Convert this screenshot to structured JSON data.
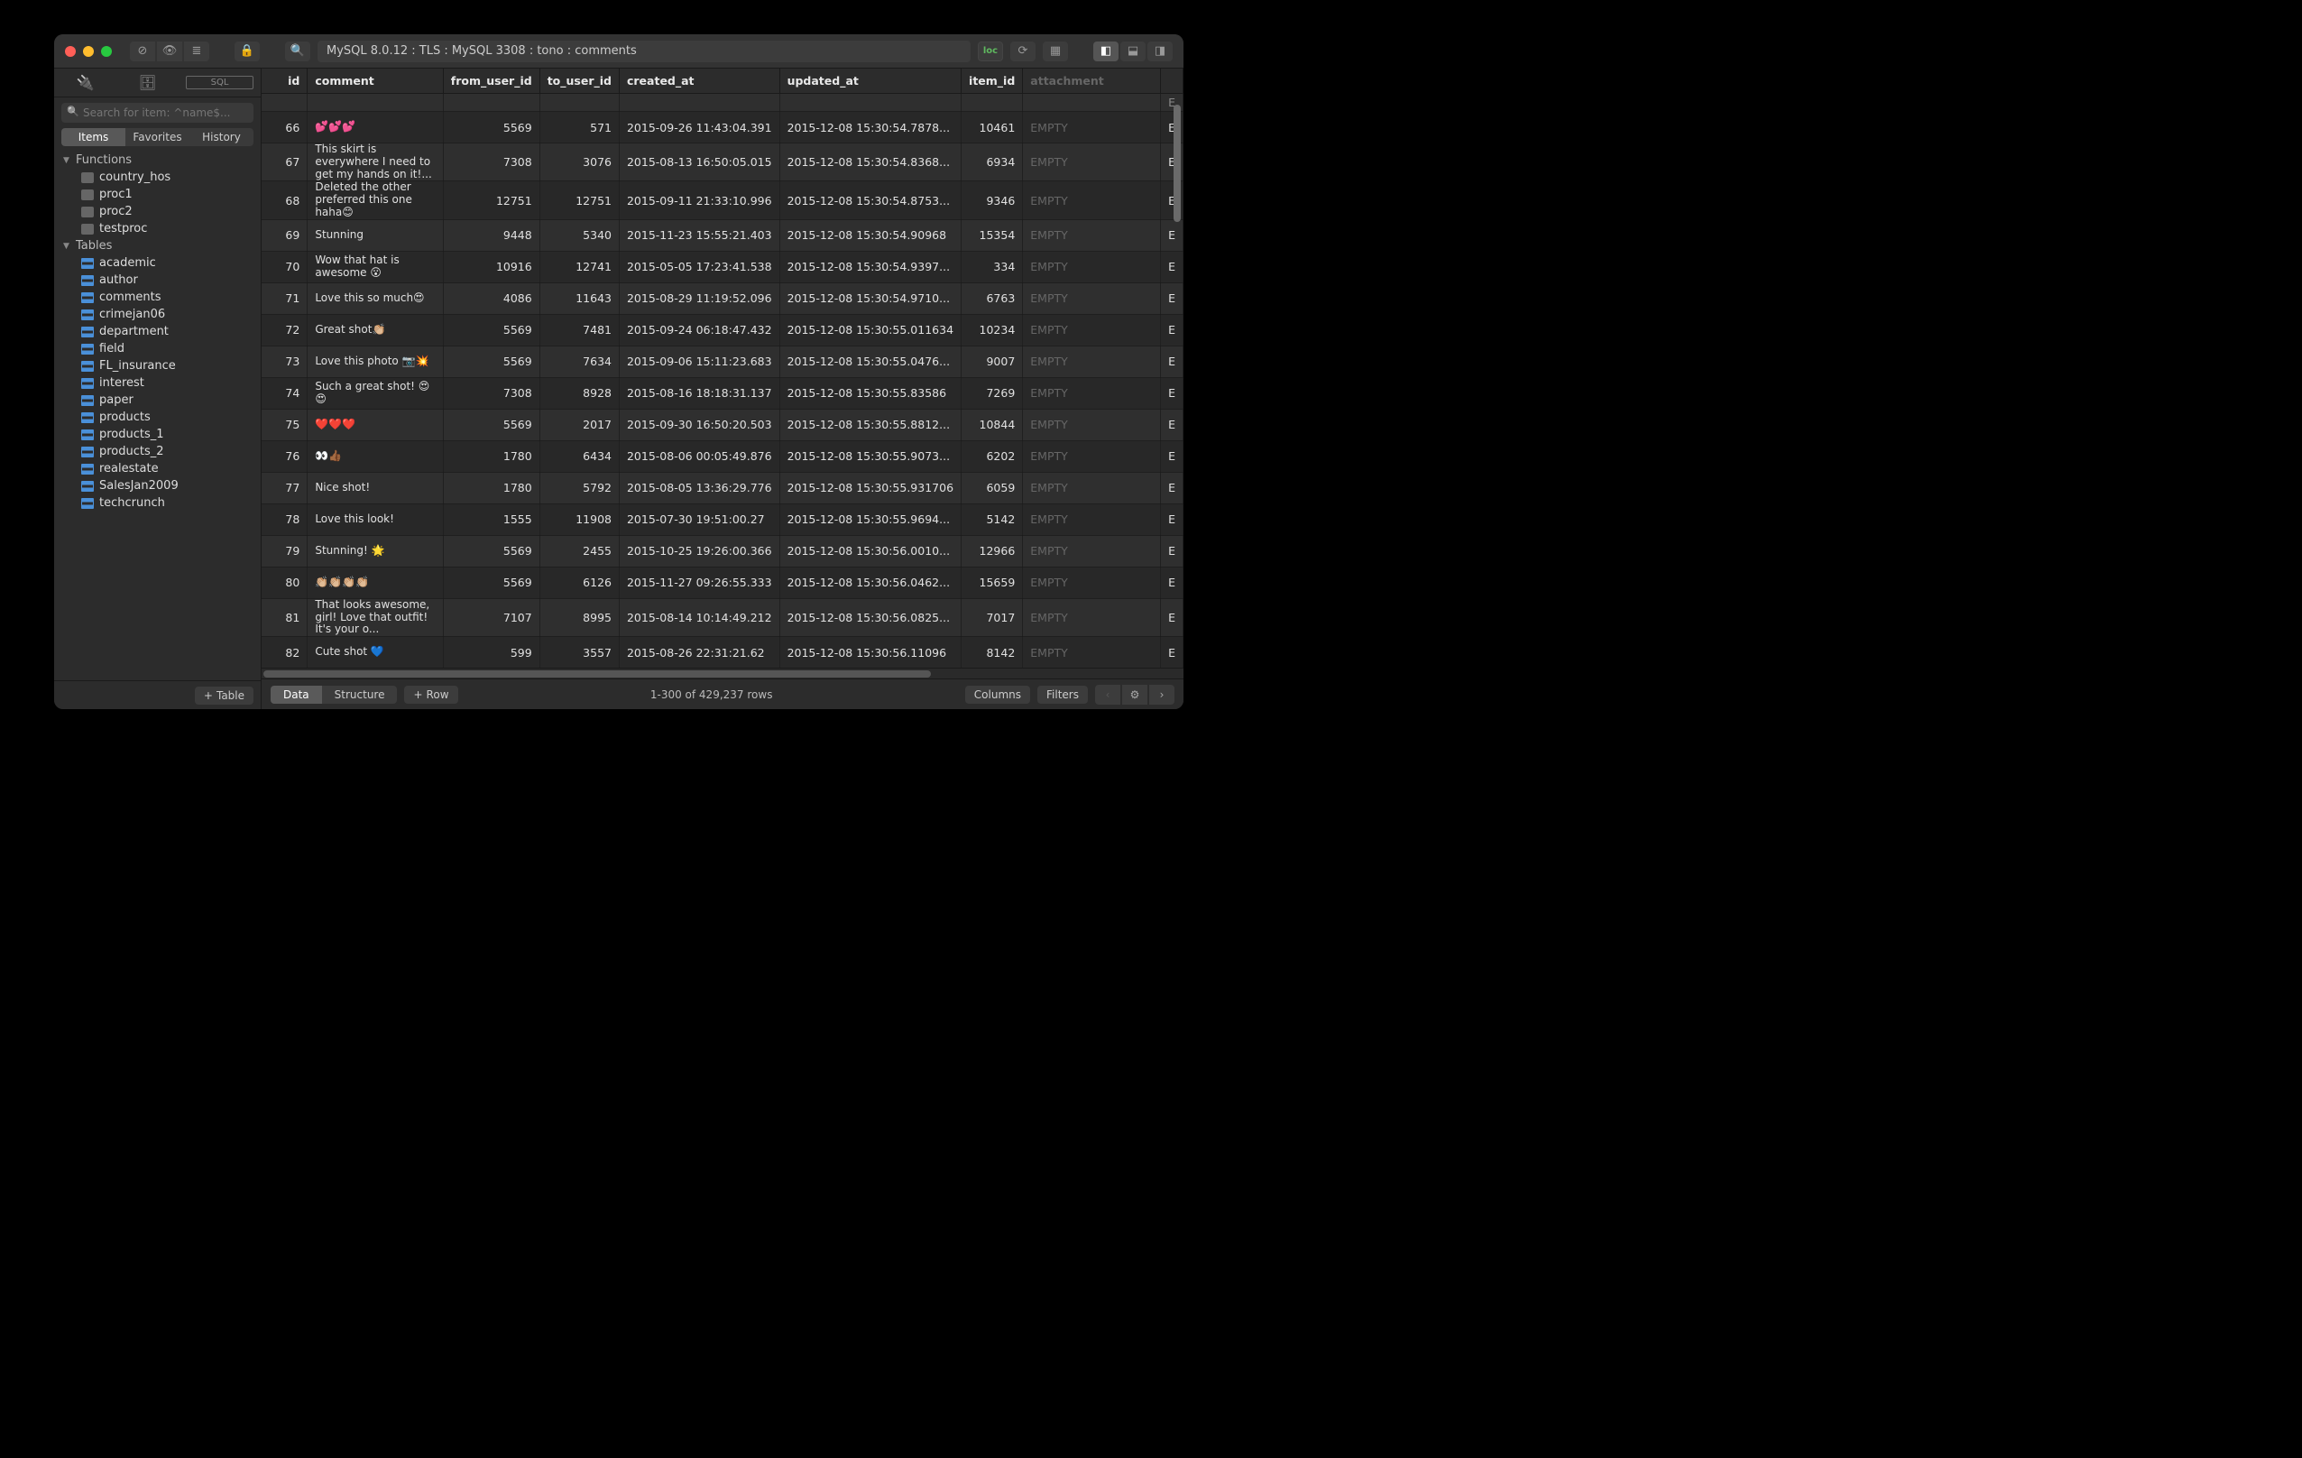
{
  "titlebar": {
    "breadcrumb": "MySQL 8.0.12 : TLS : MySQL 3308 : tono : comments",
    "loc_badge": "loc"
  },
  "sidebar": {
    "search_placeholder": "Search for item: ^name$...",
    "segments": [
      "Items",
      "Favorites",
      "History"
    ],
    "groups": [
      {
        "label": "Functions",
        "icon": "fn",
        "items": [
          "country_hos",
          "proc1",
          "proc2",
          "testproc"
        ]
      },
      {
        "label": "Tables",
        "icon": "tbl",
        "items": [
          "academic",
          "author",
          "comments",
          "crimejan06",
          "department",
          "field",
          "FL_insurance",
          "interest",
          "paper",
          "products",
          "products_1",
          "products_2",
          "realestate",
          "SalesJan2009",
          "techcrunch"
        ]
      }
    ],
    "add_table_label": "Table"
  },
  "columns": [
    "id",
    "comment",
    "from_user_id",
    "to_user_id",
    "created_at",
    "updated_at",
    "item_id",
    "attachment",
    ""
  ],
  "rows": [
    {
      "id": 66,
      "comment": "💕💕💕",
      "from": 5569,
      "to": 571,
      "created": "2015-09-26 11:43:04.391",
      "updated": "2015-12-08 15:30:54.7878...",
      "item": 10461,
      "attach": "EMPTY"
    },
    {
      "id": 67,
      "comment": "This skirt is everywhere I need to get my hands on it!...",
      "from": 7308,
      "to": 3076,
      "created": "2015-08-13 16:50:05.015",
      "updated": "2015-12-08 15:30:54.8368...",
      "item": 6934,
      "attach": "EMPTY"
    },
    {
      "id": 68,
      "comment": "Deleted the other preferred this one haha😊",
      "from": 12751,
      "to": 12751,
      "created": "2015-09-11 21:33:10.996",
      "updated": "2015-12-08 15:30:54.8753...",
      "item": 9346,
      "attach": "EMPTY"
    },
    {
      "id": 69,
      "comment": "Stunning",
      "from": 9448,
      "to": 5340,
      "created": "2015-11-23 15:55:21.403",
      "updated": "2015-12-08 15:30:54.90968",
      "item": 15354,
      "attach": "EMPTY"
    },
    {
      "id": 70,
      "comment": "Wow that hat is awesome 😮",
      "from": 10916,
      "to": 12741,
      "created": "2015-05-05 17:23:41.538",
      "updated": "2015-12-08 15:30:54.9397...",
      "item": 334,
      "attach": "EMPTY"
    },
    {
      "id": 71,
      "comment": " Love this so much😍",
      "from": 4086,
      "to": 11643,
      "created": "2015-08-29 11:19:52.096",
      "updated": "2015-12-08 15:30:54.9710...",
      "item": 6763,
      "attach": "EMPTY"
    },
    {
      "id": 72,
      "comment": "Great shot👏🏼",
      "from": 5569,
      "to": 7481,
      "created": "2015-09-24 06:18:47.432",
      "updated": "2015-12-08 15:30:55.011634",
      "item": 10234,
      "attach": "EMPTY"
    },
    {
      "id": 73,
      "comment": "Love this photo 📷💥",
      "from": 5569,
      "to": 7634,
      "created": "2015-09-06 15:11:23.683",
      "updated": "2015-12-08 15:30:55.0476...",
      "item": 9007,
      "attach": "EMPTY"
    },
    {
      "id": 74,
      "comment": "Such a great shot! 😍😍",
      "from": 7308,
      "to": 8928,
      "created": "2015-08-16 18:18:31.137",
      "updated": "2015-12-08 15:30:55.83586",
      "item": 7269,
      "attach": "EMPTY"
    },
    {
      "id": 75,
      "comment": "❤️❤️❤️",
      "from": 5569,
      "to": 2017,
      "created": "2015-09-30 16:50:20.503",
      "updated": "2015-12-08 15:30:55.8812...",
      "item": 10844,
      "attach": "EMPTY"
    },
    {
      "id": 76,
      "comment": "👀👍🏾",
      "from": 1780,
      "to": 6434,
      "created": "2015-08-06 00:05:49.876",
      "updated": "2015-12-08 15:30:55.9073...",
      "item": 6202,
      "attach": "EMPTY"
    },
    {
      "id": 77,
      "comment": "Nice shot!",
      "from": 1780,
      "to": 5792,
      "created": "2015-08-05 13:36:29.776",
      "updated": "2015-12-08 15:30:55.931706",
      "item": 6059,
      "attach": "EMPTY"
    },
    {
      "id": 78,
      "comment": "Love this look!",
      "from": 1555,
      "to": 11908,
      "created": "2015-07-30 19:51:00.27",
      "updated": "2015-12-08 15:30:55.9694...",
      "item": 5142,
      "attach": "EMPTY"
    },
    {
      "id": 79,
      "comment": "Stunning! 🌟",
      "from": 5569,
      "to": 2455,
      "created": "2015-10-25 19:26:00.366",
      "updated": "2015-12-08 15:30:56.0010...",
      "item": 12966,
      "attach": "EMPTY"
    },
    {
      "id": 80,
      "comment": "👏🏼👏🏼👏🏼👏🏼",
      "from": 5569,
      "to": 6126,
      "created": "2015-11-27 09:26:55.333",
      "updated": "2015-12-08 15:30:56.0462...",
      "item": 15659,
      "attach": "EMPTY"
    },
    {
      "id": 81,
      "comment": "That looks awesome, girl! Love that outfit! It's your o...",
      "from": 7107,
      "to": 8995,
      "created": "2015-08-14 10:14:49.212",
      "updated": "2015-12-08 15:30:56.0825...",
      "item": 7017,
      "attach": "EMPTY"
    },
    {
      "id": 82,
      "comment": "Cute shot 💙",
      "from": 599,
      "to": 3557,
      "created": "2015-08-26 22:31:21.62",
      "updated": "2015-12-08 15:30:56.11096",
      "item": 8142,
      "attach": "EMPTY"
    }
  ],
  "footer": {
    "tabs": [
      "Data",
      "Structure"
    ],
    "add_row_label": "Row",
    "status": "1-300 of 429,237 rows",
    "columns_label": "Columns",
    "filters_label": "Filters"
  }
}
